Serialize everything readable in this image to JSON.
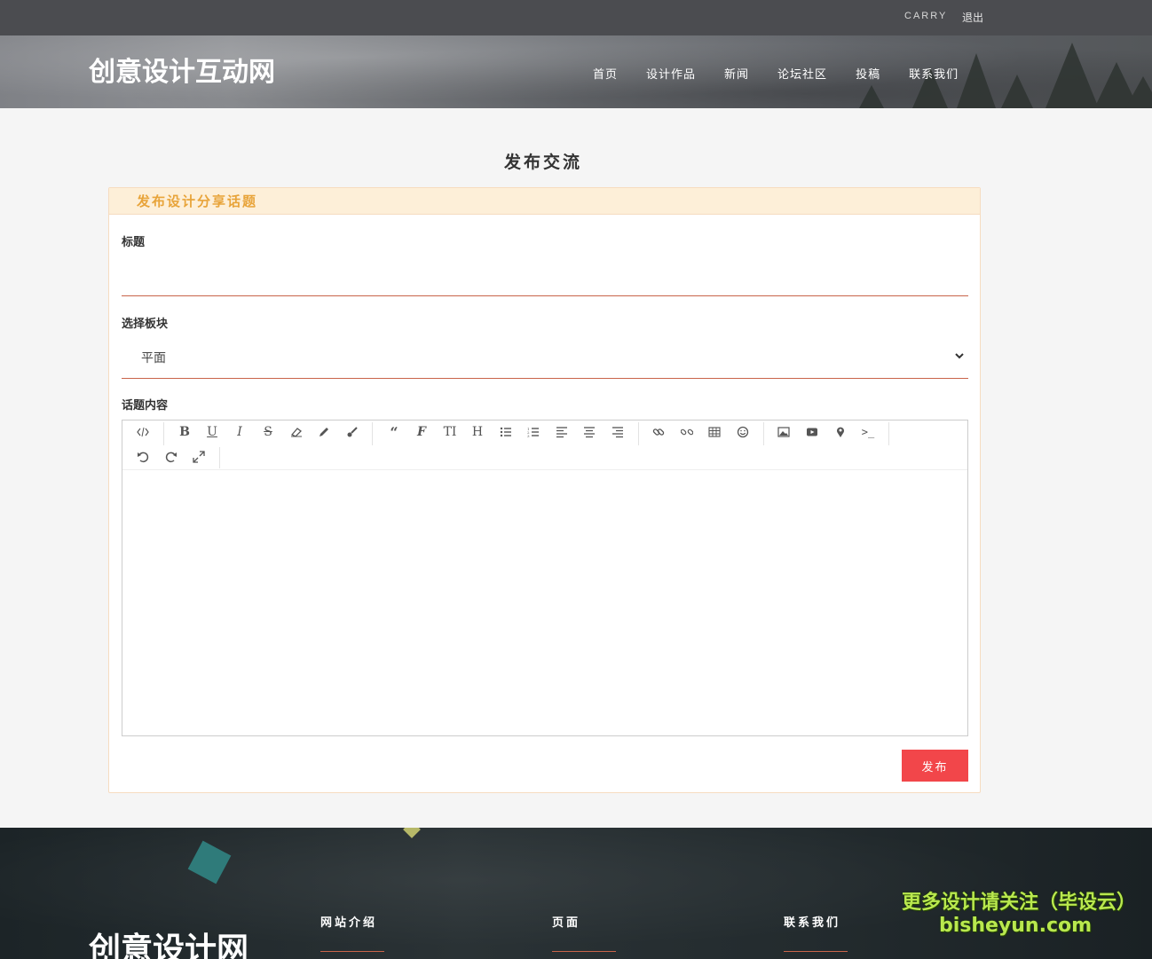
{
  "topbar": {
    "username": "CARRY",
    "logout": "退出"
  },
  "header": {
    "logo": "创意设计互动网",
    "nav": [
      "首页",
      "设计作品",
      "新闻",
      "论坛社区",
      "投稿",
      "联系我们"
    ]
  },
  "page": {
    "title": "发布交流"
  },
  "form": {
    "panel_title": "发布设计分享话题",
    "title_label": "标题",
    "title_value": "",
    "board_label": "选择板块",
    "board_selected": "平面",
    "content_label": "话题内容",
    "submit_label": "发布"
  },
  "toolbar_icons": [
    "source-code-icon",
    "bold-icon",
    "underline-icon",
    "italic-icon",
    "strikethrough-icon",
    "eraser-icon",
    "pencil-icon",
    "paintbrush-icon",
    "quote-icon",
    "font-icon",
    "font-size-icon",
    "heading-icon",
    "bullet-list-icon",
    "numbered-list-icon",
    "align-left-icon",
    "align-center-icon",
    "align-right-icon",
    "link-icon",
    "unlink-icon",
    "table-icon",
    "emoji-icon",
    "image-icon",
    "video-icon",
    "map-pin-icon",
    "code-block-icon",
    "undo-icon",
    "redo-icon",
    "fullscreen-icon"
  ],
  "footer": {
    "logo": "创意设计网",
    "col1": "网站介绍",
    "col2": "页面",
    "col3": "联系我们",
    "watermark_line1": "更多设计请关注（毕设云）",
    "watermark_line2": "bisheyun.com"
  },
  "colors": {
    "accent": "#f2464a",
    "underline": "#c9644a",
    "panel_head_bg": "#fdefd8",
    "panel_head_text": "#e8a43a"
  }
}
